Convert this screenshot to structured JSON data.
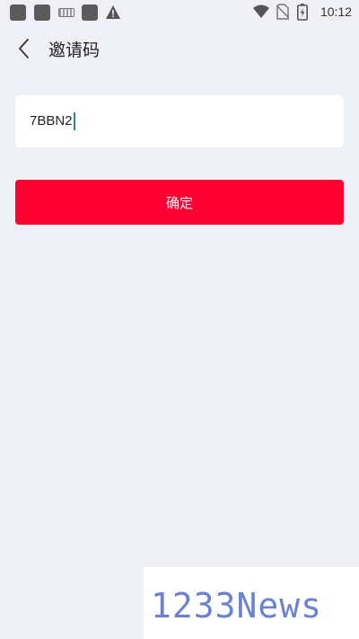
{
  "status_bar": {
    "time": "10:12",
    "left_icons": [
      "app-icon",
      "app-icon",
      "keyboard-icon",
      "app-icon",
      "warning-icon"
    ],
    "right_icons": [
      "wifi-icon",
      "no-sim-icon",
      "battery-charging-icon"
    ]
  },
  "header": {
    "back_icon": "chevron-left-icon",
    "title": "邀请码"
  },
  "invite": {
    "value": "7BBN2"
  },
  "confirm": {
    "label": "确定",
    "color": "#ff0033"
  },
  "watermark": {
    "text": "1233News",
    "color": "#4f6ec9"
  }
}
